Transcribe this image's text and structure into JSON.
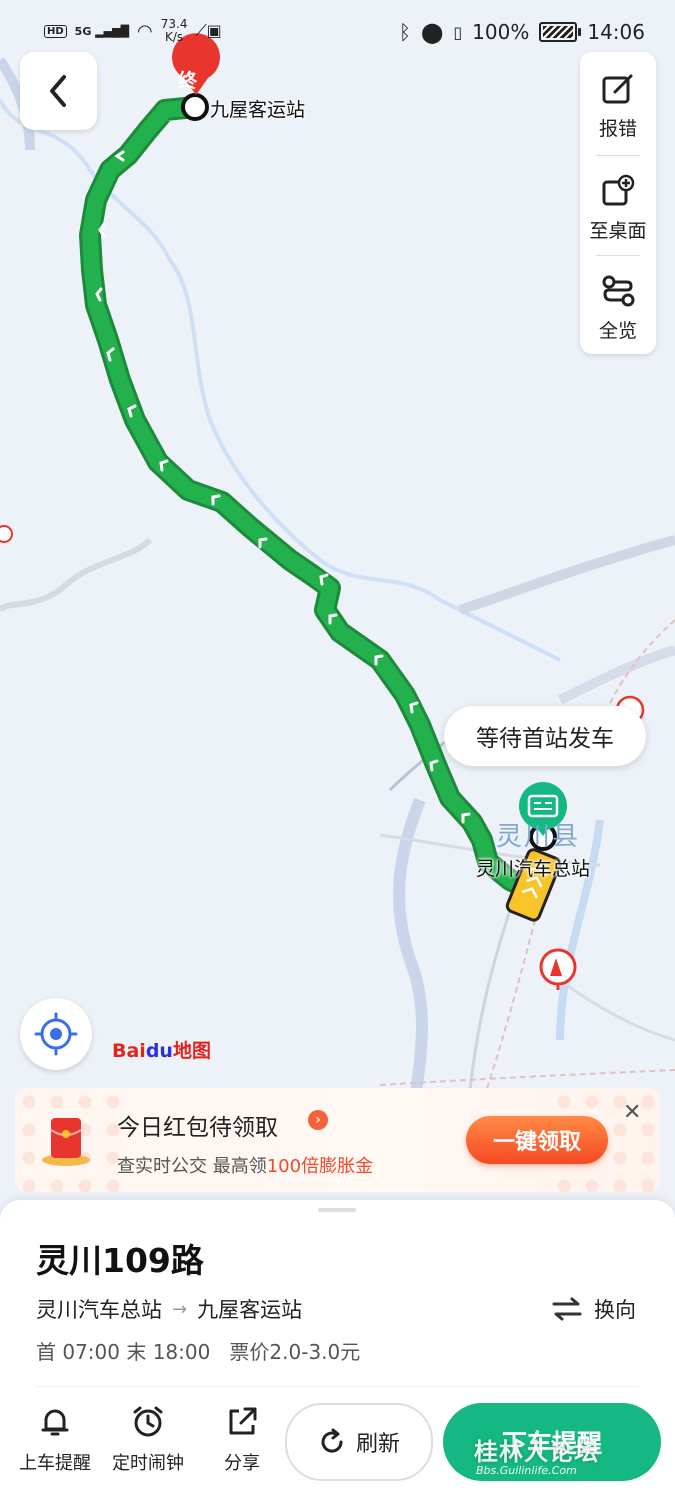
{
  "status_bar": {
    "network_badge": "HD",
    "signal": "5G",
    "speed_value": "73.4",
    "speed_unit": "K/s",
    "battery": "100%",
    "time": "14:06"
  },
  "map": {
    "end_marker": "终",
    "end_stop": "九屋客运站",
    "start_stop": "灵川汽车总站",
    "town": "灵川县",
    "bubble_text": "等待首站发车",
    "logo_text": "Bai",
    "logo_du": "du",
    "logo_map": "地图",
    "route_color": "#22b14c"
  },
  "side_panel": {
    "report": "报错",
    "desktop": "至桌面",
    "overview": "全览"
  },
  "promo": {
    "title": "今日红包待领取",
    "sub_prefix": "查实时公交 最高领",
    "sub_highlight": "100倍膨胀金",
    "button": "一键领取"
  },
  "route": {
    "name": "灵川109路",
    "from": "灵川汽车总站",
    "arrow": "→",
    "to": "九屋客运站",
    "reverse": "换向",
    "times": "首 07:00 末 18:00   票价2.0-3.0元"
  },
  "bottom_bar": {
    "board_alert": "上车提醒",
    "timer": "定时闹钟",
    "share": "分享",
    "refresh": "刷新",
    "alight_alert": "下车提醒"
  },
  "watermark": {
    "text": "桂林人论坛",
    "url": "Bbs.Guilinlife.Com"
  }
}
